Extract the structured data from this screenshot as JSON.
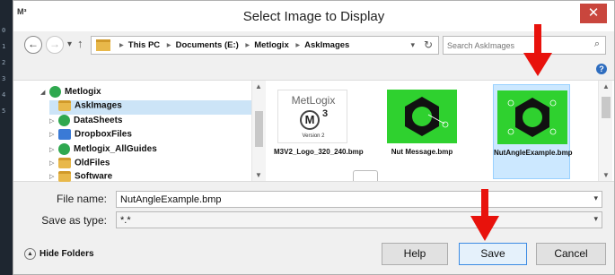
{
  "window": {
    "app_icon": "M³",
    "title": "Select Image to Display",
    "close_glyph": "✕"
  },
  "nav": {
    "back_glyph": "←",
    "forward_glyph": "→",
    "recent_glyph": "▾",
    "up_glyph": "↑",
    "breadcrumbs": [
      "This PC",
      "Documents (E:)",
      "Metlogix",
      "AskImages"
    ],
    "search_placeholder": "Search AskImages"
  },
  "tree": {
    "items": [
      {
        "label": "Metlogix",
        "icon": "green-circle-icon",
        "expanded": true
      },
      {
        "label": "AskImages",
        "icon": "folder-icon",
        "selected": true
      },
      {
        "label": "DataSheets",
        "icon": "green-circle-icon"
      },
      {
        "label": "DropboxFiles",
        "icon": "dropbox-icon"
      },
      {
        "label": "Metlogix_AllGuides",
        "icon": "green-circle-icon"
      },
      {
        "label": "OldFiles",
        "icon": "folder-icon"
      },
      {
        "label": "Software",
        "icon": "folder-icon"
      }
    ]
  },
  "files": [
    {
      "name": "M3V2_Logo_320_240.bmp",
      "thumb": "metlogix-logo",
      "logo_text": "MetLogix",
      "logo_mark": "M",
      "logo_sup": "3",
      "logo_version": "Version 2"
    },
    {
      "name": "Nut Message.bmp",
      "thumb": "nut",
      "selected": false
    },
    {
      "name": "NutAngleExample.bmp",
      "thumb": "nut-angle",
      "selected": true
    }
  ],
  "form": {
    "file_name_label": "File name:",
    "file_name_value": "NutAngleExample.bmp",
    "save_as_type_label": "Save as type:",
    "save_as_type_value": "*.*"
  },
  "footer": {
    "hide_folders_label": "Hide Folders",
    "help_label": "Help",
    "save_label": "Save",
    "cancel_label": "Cancel"
  },
  "colors": {
    "annotation_arrow": "#e8120c",
    "thumbnail_background": "#2fd12f",
    "selection": "#cce8ff",
    "close_button": "#c9463d"
  }
}
